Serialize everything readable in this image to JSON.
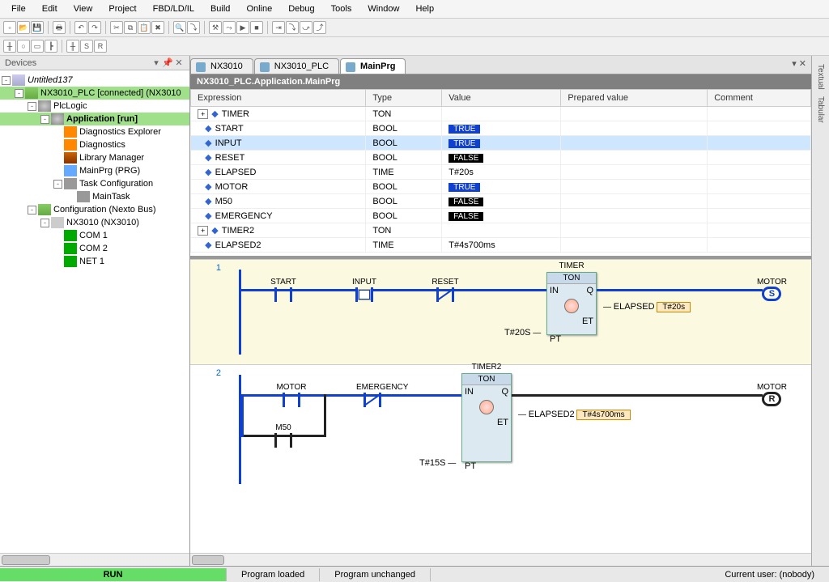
{
  "menu": [
    "File",
    "Edit",
    "View",
    "Project",
    "FBD/LD/IL",
    "Build",
    "Online",
    "Debug",
    "Tools",
    "Window",
    "Help"
  ],
  "panels": {
    "devices_title": "Devices",
    "project": "Untitled137"
  },
  "tree": [
    {
      "ind": 0,
      "exp": "-",
      "ico": "ic-proj",
      "label": "Untitled137",
      "style": "italic"
    },
    {
      "ind": 1,
      "exp": "-",
      "ico": "ic-plc",
      "label": "NX3010_PLC [connected] (NX3010",
      "sel": true
    },
    {
      "ind": 2,
      "exp": "-",
      "ico": "ic-cog",
      "label": "PlcLogic"
    },
    {
      "ind": 3,
      "exp": "-",
      "ico": "ic-cog",
      "label": "Application [run]",
      "bold": true,
      "hl": true
    },
    {
      "ind": 4,
      "exp": "",
      "ico": "ic-diag",
      "label": "Diagnostics Explorer"
    },
    {
      "ind": 4,
      "exp": "",
      "ico": "ic-diag",
      "label": "Diagnostics"
    },
    {
      "ind": 4,
      "exp": "",
      "ico": "ic-book",
      "label": "Library Manager"
    },
    {
      "ind": 4,
      "exp": "",
      "ico": "ic-prg",
      "label": "MainPrg (PRG)"
    },
    {
      "ind": 4,
      "exp": "-",
      "ico": "ic-task",
      "label": "Task Configuration"
    },
    {
      "ind": 5,
      "exp": "",
      "ico": "ic-task",
      "label": "MainTask"
    },
    {
      "ind": 2,
      "exp": "-",
      "ico": "ic-cfg",
      "label": "Configuration (Nexto Bus)"
    },
    {
      "ind": 3,
      "exp": "-",
      "ico": "ic-bus",
      "label": "NX3010 (NX3010)"
    },
    {
      "ind": 4,
      "exp": "",
      "ico": "ic-port",
      "label": "COM 1"
    },
    {
      "ind": 4,
      "exp": "",
      "ico": "ic-port",
      "label": "COM 2"
    },
    {
      "ind": 4,
      "exp": "",
      "ico": "ic-port",
      "label": "NET 1"
    }
  ],
  "tabs": [
    {
      "label": "NX3010",
      "active": false
    },
    {
      "label": "NX3010_PLC",
      "active": false
    },
    {
      "label": "MainPrg",
      "active": true
    }
  ],
  "crumb": "NX3010_PLC.Application.MainPrg",
  "grid_headers": [
    "Expression",
    "Type",
    "Value",
    "Prepared value",
    "Comment"
  ],
  "vars": [
    {
      "exp": "TIMER",
      "type": "TON",
      "value": "",
      "kind": "",
      "plus": "+"
    },
    {
      "exp": "START",
      "type": "BOOL",
      "value": "TRUE",
      "kind": "true"
    },
    {
      "exp": "INPUT",
      "type": "BOOL",
      "value": "TRUE",
      "kind": "true",
      "sel": true
    },
    {
      "exp": "RESET",
      "type": "BOOL",
      "value": "FALSE",
      "kind": "false"
    },
    {
      "exp": "ELAPSED",
      "type": "TIME",
      "value": "T#20s",
      "kind": "plain"
    },
    {
      "exp": "MOTOR",
      "type": "BOOL",
      "value": "TRUE",
      "kind": "true"
    },
    {
      "exp": "M50",
      "type": "BOOL",
      "value": "FALSE",
      "kind": "false"
    },
    {
      "exp": "EMERGENCY",
      "type": "BOOL",
      "value": "FALSE",
      "kind": "false"
    },
    {
      "exp": "TIMER2",
      "type": "TON",
      "value": "",
      "kind": "",
      "plus": "+"
    },
    {
      "exp": "ELAPSED2",
      "type": "TIME",
      "value": "T#4s700ms",
      "kind": "plain"
    }
  ],
  "ladder": {
    "rung1": {
      "n": "1",
      "start": "START",
      "input": "INPUT",
      "reset": "RESET",
      "block": "TIMER",
      "blocktype": "TON",
      "et": "ELAPSED",
      "etv": "T#20s",
      "pt": "T#20S",
      "out": "MOTOR"
    },
    "rung2": {
      "n": "2",
      "motor": "MOTOR",
      "emg": "EMERGENCY",
      "m50": "M50",
      "block": "TIMER2",
      "blocktype": "TON",
      "et": "ELAPSED2",
      "etv": "T#4s700ms",
      "pt": "T#15S",
      "out": "MOTOR"
    }
  },
  "rside": [
    "Textual",
    "Tabular"
  ],
  "status": {
    "run": "RUN",
    "loaded": "Program loaded",
    "changed": "Program unchanged",
    "user": "Current user: (nobody)"
  }
}
